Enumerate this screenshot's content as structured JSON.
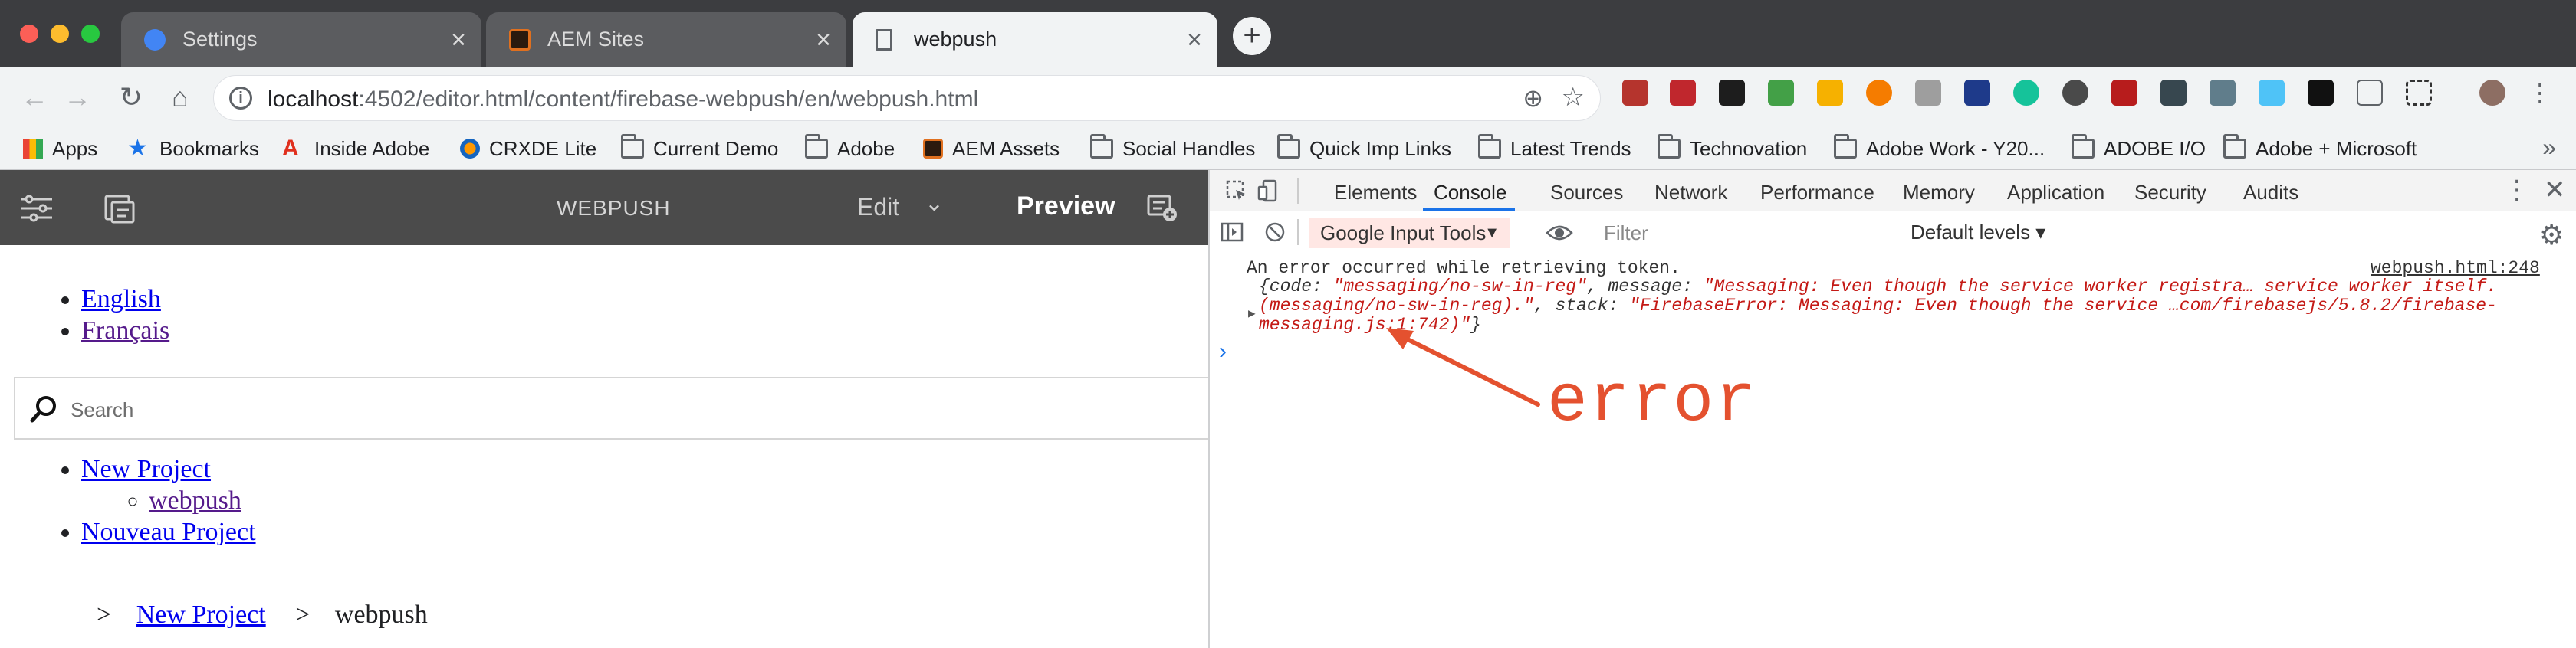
{
  "browser": {
    "tabs": [
      {
        "label": "Settings",
        "icon": "gear-icon",
        "color": "#4285f4"
      },
      {
        "label": "AEM Sites",
        "icon": "aem-icon",
        "color": "#e0701f"
      },
      {
        "label": "webpush",
        "icon": "document-icon",
        "active": true
      }
    ],
    "close_glyph": "×",
    "new_tab_glyph": "+",
    "url_host": "localhost",
    "url_rest": ":4502/editor.html/content/firebase-webpush/en/webpush.html"
  },
  "bookmarks": {
    "items": [
      {
        "label": "Apps",
        "icon": "apps-grid-icon"
      },
      {
        "label": "Bookmarks",
        "icon": "star-icon"
      },
      {
        "label": "Inside Adobe",
        "icon": "adobe-icon"
      },
      {
        "label": "CRXDE Lite",
        "icon": "crxde-icon"
      },
      {
        "label": "Current Demo",
        "icon": "folder-icon"
      },
      {
        "label": "Adobe",
        "icon": "folder-icon"
      },
      {
        "label": "AEM Assets",
        "icon": "aem-icon"
      },
      {
        "label": "Social Handles",
        "icon": "folder-icon"
      },
      {
        "label": "Quick Imp Links",
        "icon": "folder-icon"
      },
      {
        "label": "Latest Trends",
        "icon": "folder-icon"
      },
      {
        "label": "Technovation",
        "icon": "folder-icon"
      },
      {
        "label": "Adobe Work - Y20...",
        "icon": "folder-icon"
      },
      {
        "label": "ADOBE I/O",
        "icon": "folder-icon"
      },
      {
        "label": "Adobe + Microsoft",
        "icon": "folder-icon"
      }
    ],
    "more": "»"
  },
  "aem": {
    "page_title": "WEBPUSH",
    "edit_label": "Edit",
    "preview_label": "Preview",
    "languages": [
      "English",
      "Français"
    ],
    "search_placeholder": "Search",
    "nav": {
      "project": "New Project",
      "child": "webpush",
      "other": "Nouveau Project"
    },
    "breadcrumb": {
      "sep": ">",
      "parent": "New Project",
      "current": "webpush"
    }
  },
  "devtools": {
    "tabs": [
      "Elements",
      "Console",
      "Sources",
      "Network",
      "Performance",
      "Memory",
      "Application",
      "Security",
      "Audits"
    ],
    "active_tab": "Console",
    "context": "Google Input Tools",
    "filter_placeholder": "Filter",
    "levels": "Default levels ▾",
    "error": {
      "message": "An error occurred while retrieving token.",
      "source": "webpush.html:248",
      "obj_open": "{code: ",
      "code": "\"messaging/no-sw-in-reg\"",
      "message_key": ", message: ",
      "message_value": "\"Messaging: Even though the service worker registra… service worker itself. (messaging/no-sw-in-reg).\"",
      "stack_key": ", stack: ",
      "stack_value": "\"FirebaseError: Messaging: Even though the service …com/firebasejs/5.8.2/firebase-messaging.js:1:742)\"",
      "obj_close": "}"
    },
    "prompt": "›"
  },
  "annotation": {
    "text": "error",
    "color": "#e4512f"
  }
}
